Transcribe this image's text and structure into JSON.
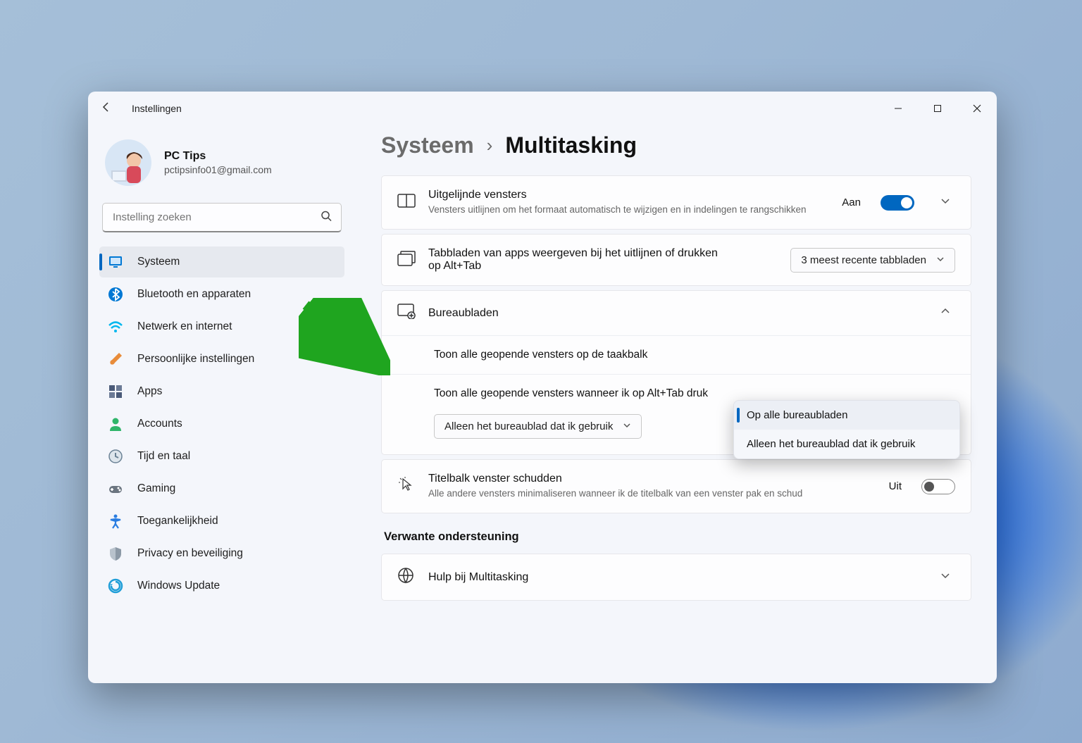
{
  "app_title": "Instellingen",
  "profile": {
    "name": "PC Tips",
    "email": "pctipsinfo01@gmail.com"
  },
  "search": {
    "placeholder": "Instelling zoeken"
  },
  "sidebar": {
    "items": [
      {
        "label": "Systeem",
        "icon": "system",
        "color": "#0078d4",
        "active": true
      },
      {
        "label": "Bluetooth en apparaten",
        "icon": "bluetooth",
        "color": "#0078d4"
      },
      {
        "label": "Netwerk en internet",
        "icon": "wifi",
        "color": "#00b7ee"
      },
      {
        "label": "Persoonlijke instellingen",
        "icon": "brush",
        "color": "#e88c3a"
      },
      {
        "label": "Apps",
        "icon": "apps",
        "color": "#4a5a78"
      },
      {
        "label": "Accounts",
        "icon": "person",
        "color": "#2fb56a"
      },
      {
        "label": "Tijd en taal",
        "icon": "clock",
        "color": "#6b8295"
      },
      {
        "label": "Gaming",
        "icon": "gamepad",
        "color": "#6b7580"
      },
      {
        "label": "Toegankelijkheid",
        "icon": "access",
        "color": "#2a7de1"
      },
      {
        "label": "Privacy en beveiliging",
        "icon": "shield",
        "color": "#8c99a6"
      },
      {
        "label": "Windows Update",
        "icon": "update",
        "color": "#1f9ed8"
      }
    ]
  },
  "breadcrumb": {
    "parent": "Systeem",
    "current": "Multitasking"
  },
  "snap": {
    "title": "Uitgelijnde vensters",
    "subtitle": "Vensters uitlijnen om het formaat automatisch te wijzigen en in indelingen te rangschikken",
    "state_label": "Aan",
    "state": true
  },
  "alt_tab": {
    "title": "Tabbladen van apps weergeven bij het uitlijnen of drukken op Alt+Tab",
    "selected": "3 meest recente tabbladen"
  },
  "desktops": {
    "title": "Bureaubladen",
    "taskbar_label": "Toon alle geopende vensters op de taakbalk",
    "alttab_label": "Toon alle geopende vensters wanneer ik op Alt+Tab druk",
    "alttab_selected": "Alleen het bureaublad dat ik gebruik",
    "dropdown_options": [
      "Op alle bureaubladen",
      "Alleen het bureaublad dat ik gebruik"
    ],
    "dropdown_selected_index": 0
  },
  "shake": {
    "title": "Titelbalk venster schudden",
    "subtitle": "Alle andere vensters minimaliseren wanneer ik de titelbalk van een venster pak en schud",
    "state_label": "Uit",
    "state": false
  },
  "related_heading": "Verwante ondersteuning",
  "help_row": {
    "title": "Hulp bij Multitasking"
  }
}
